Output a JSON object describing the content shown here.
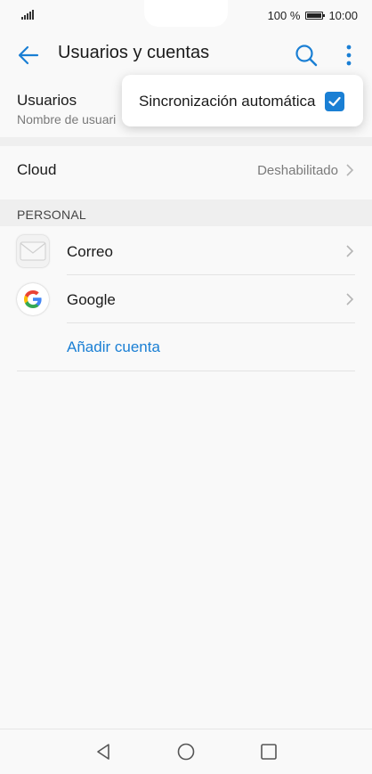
{
  "status_bar": {
    "battery_percent": "100 %",
    "time": "10:00"
  },
  "app_bar": {
    "title": "Usuarios y cuentas"
  },
  "users_row": {
    "title": "Usuarios",
    "subtitle": "Nombre de usuari"
  },
  "cloud_row": {
    "title": "Cloud",
    "value": "Deshabilitado"
  },
  "section": {
    "header": "PERSONAL"
  },
  "accounts": [
    {
      "label": "Correo",
      "icon": "mail-icon"
    },
    {
      "label": "Google",
      "icon": "google-icon"
    }
  ],
  "add_account_label": "Añadir cuenta",
  "popup_menu": {
    "label": "Sincronización automática",
    "checked": true
  },
  "colors": {
    "accent": "#1a7fd4",
    "background": "#f9f9f9",
    "band": "#efefef"
  }
}
